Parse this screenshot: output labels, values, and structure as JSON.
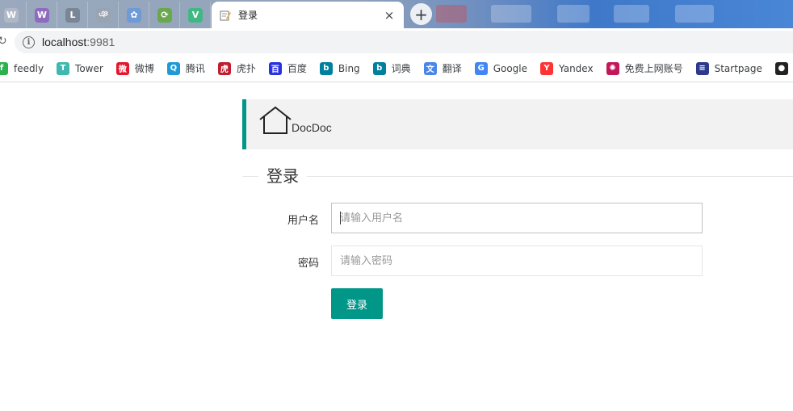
{
  "browser": {
    "active_tab": {
      "title": "登录",
      "close_glyph": "×"
    },
    "new_tab_glyph": "+",
    "address": {
      "host": "localhost",
      "port": ":9981"
    },
    "pinned_tabs": [
      {
        "icon": "wiki-icon",
        "letter": "W",
        "color": "#b0b8c8"
      },
      {
        "icon": "vs-icon",
        "letter": "W",
        "color": "#8f6bbf"
      },
      {
        "icon": "chart-icon",
        "letter": "L",
        "color": "#7a8696"
      },
      {
        "icon": "script-icon",
        "letter": "ঞ",
        "color": "#9aa4b1"
      },
      {
        "icon": "baidu-paw-icon",
        "letter": "✿",
        "color": "#6f9ad8"
      },
      {
        "icon": "spring-icon",
        "letter": "⟳",
        "color": "#6aa84f"
      },
      {
        "icon": "vue-icon",
        "letter": "V",
        "color": "#41b883"
      }
    ]
  },
  "bookmarks": [
    {
      "label": "feedly",
      "icon": "feedly-icon",
      "color": "#2bb24c",
      "glyph": "f"
    },
    {
      "label": "Tower",
      "icon": "tower-icon",
      "color": "#3fb8af",
      "glyph": "T"
    },
    {
      "label": "微博",
      "icon": "weibo-icon",
      "color": "#e6162d",
      "glyph": "微"
    },
    {
      "label": "腾讯",
      "icon": "tencent-icon",
      "color": "#1e9bd7",
      "glyph": "Q"
    },
    {
      "label": "虎扑",
      "icon": "hupu-icon",
      "color": "#c01e2f",
      "glyph": "虎"
    },
    {
      "label": "百度",
      "icon": "baidu-icon",
      "color": "#2932e1",
      "glyph": "百"
    },
    {
      "label": "Bing",
      "icon": "bing-icon",
      "color": "#00809d",
      "glyph": "b"
    },
    {
      "label": "词典",
      "icon": "dict-icon",
      "color": "#00809d",
      "glyph": "b"
    },
    {
      "label": "翻译",
      "icon": "translate-icon",
      "color": "#4a86e8",
      "glyph": "文"
    },
    {
      "label": "Google",
      "icon": "google-icon",
      "color": "#4285f4",
      "glyph": "G"
    },
    {
      "label": "Yandex",
      "icon": "yandex-icon",
      "color": "#f33",
      "glyph": "Y"
    },
    {
      "label": "免费上网账号",
      "icon": "lollipop-icon",
      "color": "#c2185b",
      "glyph": "✺"
    },
    {
      "label": "Startpage",
      "icon": "startpage-icon",
      "color": "#2d3a8c",
      "glyph": "≡"
    },
    {
      "label": "",
      "icon": "github-icon",
      "color": "#222222",
      "glyph": "●"
    }
  ],
  "page": {
    "logo_text": "DocDoc",
    "legend": "登录",
    "username": {
      "label": "用户名",
      "placeholder": "请输入用户名",
      "value": ""
    },
    "password": {
      "label": "密码",
      "placeholder": "请输入密码",
      "value": ""
    },
    "submit_label": "登录",
    "accent": "#009688"
  }
}
